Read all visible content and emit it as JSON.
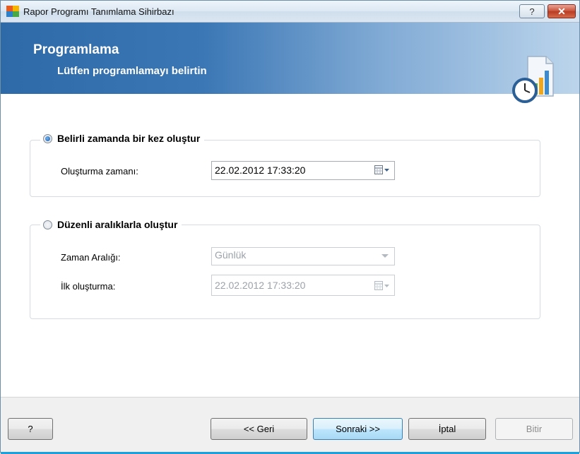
{
  "window": {
    "title": "Rapor Programı Tanımlama Sihirbazı",
    "help_glyph": "?",
    "close_glyph": "✕"
  },
  "banner": {
    "title": "Programlama",
    "subtitle": "Lütfen programlamayı belirtin",
    "icon": "schedule-report-icon"
  },
  "option_once": {
    "label": "Belirli zamanda bir kez oluştur",
    "selected": true,
    "time_label": "Oluşturma zamanı:",
    "time_value": "22.02.2012 17:33:20"
  },
  "option_interval": {
    "label": "Düzenli aralıklarla oluştur",
    "selected": false,
    "interval_label": "Zaman Aralığı:",
    "interval_value": "Günlük",
    "first_label": "İlk oluşturma:",
    "first_value": "22.02.2012 17:33:20"
  },
  "footer": {
    "help_label": "?",
    "back_label": "<< Geri",
    "next_label": "Sonraki >>",
    "cancel_label": "İptal",
    "finish_label": "Bitir"
  },
  "colors": {
    "banner": "#2f6aa8",
    "accent": "#1fa0d8"
  }
}
